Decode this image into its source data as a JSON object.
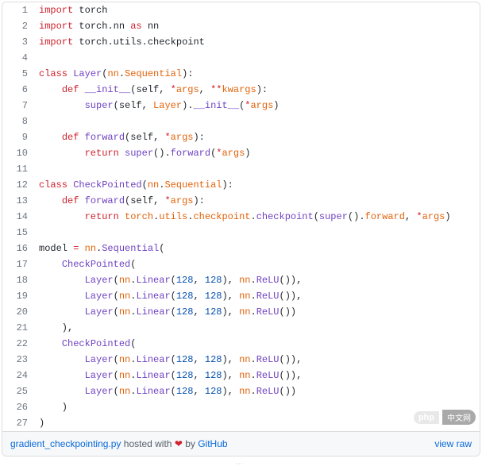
{
  "lines": [
    [
      {
        "t": "import ",
        "c": "kw"
      },
      {
        "t": "torch",
        "c": "id"
      }
    ],
    [
      {
        "t": "import ",
        "c": "kw"
      },
      {
        "t": "torch",
        "c": "id"
      },
      {
        "t": ".",
        "c": "id"
      },
      {
        "t": "nn",
        "c": "id"
      },
      {
        "t": " as ",
        "c": "kw"
      },
      {
        "t": "nn",
        "c": "id"
      }
    ],
    [
      {
        "t": "import ",
        "c": "kw"
      },
      {
        "t": "torch",
        "c": "id"
      },
      {
        "t": ".",
        "c": "id"
      },
      {
        "t": "utils",
        "c": "id"
      },
      {
        "t": ".",
        "c": "id"
      },
      {
        "t": "checkpoint",
        "c": "id"
      }
    ],
    [],
    [
      {
        "t": "class ",
        "c": "kw"
      },
      {
        "t": "Layer",
        "c": "fn"
      },
      {
        "t": "(",
        "c": "id"
      },
      {
        "t": "nn",
        "c": "cls"
      },
      {
        "t": ".",
        "c": "id"
      },
      {
        "t": "Sequential",
        "c": "cls"
      },
      {
        "t": "):",
        "c": "id"
      }
    ],
    [
      {
        "t": "    ",
        "c": "id"
      },
      {
        "t": "def ",
        "c": "kw"
      },
      {
        "t": "__init__",
        "c": "fn"
      },
      {
        "t": "(",
        "c": "id"
      },
      {
        "t": "self",
        "c": "self"
      },
      {
        "t": ", ",
        "c": "id"
      },
      {
        "t": "*",
        "c": "op"
      },
      {
        "t": "args",
        "c": "cls"
      },
      {
        "t": ", ",
        "c": "id"
      },
      {
        "t": "**",
        "c": "op"
      },
      {
        "t": "kwargs",
        "c": "cls"
      },
      {
        "t": "):",
        "c": "id"
      }
    ],
    [
      {
        "t": "        ",
        "c": "id"
      },
      {
        "t": "super",
        "c": "fn"
      },
      {
        "t": "(",
        "c": "id"
      },
      {
        "t": "self",
        "c": "self"
      },
      {
        "t": ", ",
        "c": "id"
      },
      {
        "t": "Layer",
        "c": "cls"
      },
      {
        "t": ").",
        "c": "id"
      },
      {
        "t": "__init__",
        "c": "fn"
      },
      {
        "t": "(",
        "c": "id"
      },
      {
        "t": "*",
        "c": "op"
      },
      {
        "t": "args",
        "c": "cls"
      },
      {
        "t": ")",
        "c": "id"
      }
    ],
    [],
    [
      {
        "t": "    ",
        "c": "id"
      },
      {
        "t": "def ",
        "c": "kw"
      },
      {
        "t": "forward",
        "c": "fn"
      },
      {
        "t": "(",
        "c": "id"
      },
      {
        "t": "self",
        "c": "self"
      },
      {
        "t": ", ",
        "c": "id"
      },
      {
        "t": "*",
        "c": "op"
      },
      {
        "t": "args",
        "c": "cls"
      },
      {
        "t": "):",
        "c": "id"
      }
    ],
    [
      {
        "t": "        ",
        "c": "id"
      },
      {
        "t": "return ",
        "c": "kw"
      },
      {
        "t": "super",
        "c": "fn"
      },
      {
        "t": "().",
        "c": "id"
      },
      {
        "t": "forward",
        "c": "fn"
      },
      {
        "t": "(",
        "c": "id"
      },
      {
        "t": "*",
        "c": "op"
      },
      {
        "t": "args",
        "c": "cls"
      },
      {
        "t": ")",
        "c": "id"
      }
    ],
    [],
    [
      {
        "t": "class ",
        "c": "kw"
      },
      {
        "t": "CheckPointed",
        "c": "fn"
      },
      {
        "t": "(",
        "c": "id"
      },
      {
        "t": "nn",
        "c": "cls"
      },
      {
        "t": ".",
        "c": "id"
      },
      {
        "t": "Sequential",
        "c": "cls"
      },
      {
        "t": "):",
        "c": "id"
      }
    ],
    [
      {
        "t": "    ",
        "c": "id"
      },
      {
        "t": "def ",
        "c": "kw"
      },
      {
        "t": "forward",
        "c": "fn"
      },
      {
        "t": "(",
        "c": "id"
      },
      {
        "t": "self",
        "c": "self"
      },
      {
        "t": ", ",
        "c": "id"
      },
      {
        "t": "*",
        "c": "op"
      },
      {
        "t": "args",
        "c": "cls"
      },
      {
        "t": "):",
        "c": "id"
      }
    ],
    [
      {
        "t": "        ",
        "c": "id"
      },
      {
        "t": "return ",
        "c": "kw"
      },
      {
        "t": "torch",
        "c": "cls"
      },
      {
        "t": ".",
        "c": "id"
      },
      {
        "t": "utils",
        "c": "cls"
      },
      {
        "t": ".",
        "c": "id"
      },
      {
        "t": "checkpoint",
        "c": "cls"
      },
      {
        "t": ".",
        "c": "id"
      },
      {
        "t": "checkpoint",
        "c": "fn"
      },
      {
        "t": "(",
        "c": "id"
      },
      {
        "t": "super",
        "c": "fn"
      },
      {
        "t": "().",
        "c": "id"
      },
      {
        "t": "forward",
        "c": "cls"
      },
      {
        "t": ", ",
        "c": "id"
      },
      {
        "t": "*",
        "c": "op"
      },
      {
        "t": "args",
        "c": "cls"
      },
      {
        "t": ")",
        "c": "id"
      }
    ],
    [],
    [
      {
        "t": "model",
        "c": "var"
      },
      {
        "t": " = ",
        "c": "op"
      },
      {
        "t": "nn",
        "c": "cls"
      },
      {
        "t": ".",
        "c": "id"
      },
      {
        "t": "Sequential",
        "c": "fn"
      },
      {
        "t": "(",
        "c": "id"
      }
    ],
    [
      {
        "t": "    ",
        "c": "id"
      },
      {
        "t": "CheckPointed",
        "c": "fn"
      },
      {
        "t": "(",
        "c": "id"
      }
    ],
    [
      {
        "t": "        ",
        "c": "id"
      },
      {
        "t": "Layer",
        "c": "fn"
      },
      {
        "t": "(",
        "c": "id"
      },
      {
        "t": "nn",
        "c": "cls"
      },
      {
        "t": ".",
        "c": "id"
      },
      {
        "t": "Linear",
        "c": "fn"
      },
      {
        "t": "(",
        "c": "id"
      },
      {
        "t": "128",
        "c": "num"
      },
      {
        "t": ", ",
        "c": "id"
      },
      {
        "t": "128",
        "c": "num"
      },
      {
        "t": "), ",
        "c": "id"
      },
      {
        "t": "nn",
        "c": "cls"
      },
      {
        "t": ".",
        "c": "id"
      },
      {
        "t": "ReLU",
        "c": "fn"
      },
      {
        "t": "()),",
        "c": "id"
      }
    ],
    [
      {
        "t": "        ",
        "c": "id"
      },
      {
        "t": "Layer",
        "c": "fn"
      },
      {
        "t": "(",
        "c": "id"
      },
      {
        "t": "nn",
        "c": "cls"
      },
      {
        "t": ".",
        "c": "id"
      },
      {
        "t": "Linear",
        "c": "fn"
      },
      {
        "t": "(",
        "c": "id"
      },
      {
        "t": "128",
        "c": "num"
      },
      {
        "t": ", ",
        "c": "id"
      },
      {
        "t": "128",
        "c": "num"
      },
      {
        "t": "), ",
        "c": "id"
      },
      {
        "t": "nn",
        "c": "cls"
      },
      {
        "t": ".",
        "c": "id"
      },
      {
        "t": "ReLU",
        "c": "fn"
      },
      {
        "t": "()),",
        "c": "id"
      }
    ],
    [
      {
        "t": "        ",
        "c": "id"
      },
      {
        "t": "Layer",
        "c": "fn"
      },
      {
        "t": "(",
        "c": "id"
      },
      {
        "t": "nn",
        "c": "cls"
      },
      {
        "t": ".",
        "c": "id"
      },
      {
        "t": "Linear",
        "c": "fn"
      },
      {
        "t": "(",
        "c": "id"
      },
      {
        "t": "128",
        "c": "num"
      },
      {
        "t": ", ",
        "c": "id"
      },
      {
        "t": "128",
        "c": "num"
      },
      {
        "t": "), ",
        "c": "id"
      },
      {
        "t": "nn",
        "c": "cls"
      },
      {
        "t": ".",
        "c": "id"
      },
      {
        "t": "ReLU",
        "c": "fn"
      },
      {
        "t": "())",
        "c": "id"
      }
    ],
    [
      {
        "t": "    ),",
        "c": "id"
      }
    ],
    [
      {
        "t": "    ",
        "c": "id"
      },
      {
        "t": "CheckPointed",
        "c": "fn"
      },
      {
        "t": "(",
        "c": "id"
      }
    ],
    [
      {
        "t": "        ",
        "c": "id"
      },
      {
        "t": "Layer",
        "c": "fn"
      },
      {
        "t": "(",
        "c": "id"
      },
      {
        "t": "nn",
        "c": "cls"
      },
      {
        "t": ".",
        "c": "id"
      },
      {
        "t": "Linear",
        "c": "fn"
      },
      {
        "t": "(",
        "c": "id"
      },
      {
        "t": "128",
        "c": "num"
      },
      {
        "t": ", ",
        "c": "id"
      },
      {
        "t": "128",
        "c": "num"
      },
      {
        "t": "), ",
        "c": "id"
      },
      {
        "t": "nn",
        "c": "cls"
      },
      {
        "t": ".",
        "c": "id"
      },
      {
        "t": "ReLU",
        "c": "fn"
      },
      {
        "t": "()),",
        "c": "id"
      }
    ],
    [
      {
        "t": "        ",
        "c": "id"
      },
      {
        "t": "Layer",
        "c": "fn"
      },
      {
        "t": "(",
        "c": "id"
      },
      {
        "t": "nn",
        "c": "cls"
      },
      {
        "t": ".",
        "c": "id"
      },
      {
        "t": "Linear",
        "c": "fn"
      },
      {
        "t": "(",
        "c": "id"
      },
      {
        "t": "128",
        "c": "num"
      },
      {
        "t": ", ",
        "c": "id"
      },
      {
        "t": "128",
        "c": "num"
      },
      {
        "t": "), ",
        "c": "id"
      },
      {
        "t": "nn",
        "c": "cls"
      },
      {
        "t": ".",
        "c": "id"
      },
      {
        "t": "ReLU",
        "c": "fn"
      },
      {
        "t": "()),",
        "c": "id"
      }
    ],
    [
      {
        "t": "        ",
        "c": "id"
      },
      {
        "t": "Layer",
        "c": "fn"
      },
      {
        "t": "(",
        "c": "id"
      },
      {
        "t": "nn",
        "c": "cls"
      },
      {
        "t": ".",
        "c": "id"
      },
      {
        "t": "Linear",
        "c": "fn"
      },
      {
        "t": "(",
        "c": "id"
      },
      {
        "t": "128",
        "c": "num"
      },
      {
        "t": ", ",
        "c": "id"
      },
      {
        "t": "128",
        "c": "num"
      },
      {
        "t": "), ",
        "c": "id"
      },
      {
        "t": "nn",
        "c": "cls"
      },
      {
        "t": ".",
        "c": "id"
      },
      {
        "t": "ReLU",
        "c": "fn"
      },
      {
        "t": "())",
        "c": "id"
      }
    ],
    [
      {
        "t": "    )",
        "c": "id"
      }
    ],
    [
      {
        "t": ")",
        "c": "id"
      }
    ]
  ],
  "meta": {
    "filename": "gradient_checkpointing.py",
    "hosted_with": " hosted with ",
    "heart": "❤",
    "by": " by ",
    "github": "GitHub",
    "view_raw": "view raw"
  },
  "watermark": {
    "badge": "php",
    "text": "中文网"
  },
  "scroll_hint": "⋯"
}
